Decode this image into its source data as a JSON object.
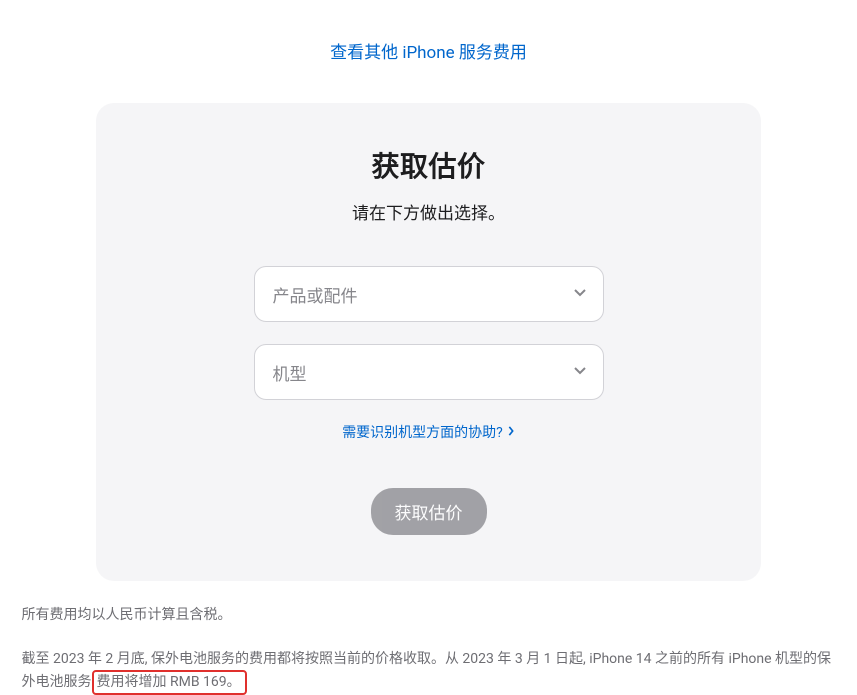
{
  "topLink": {
    "label": "查看其他 iPhone 服务费用"
  },
  "card": {
    "title": "获取估价",
    "subtitle": "请在下方做出选择。",
    "selectProduct": {
      "placeholder": "产品或配件"
    },
    "selectModel": {
      "placeholder": "机型"
    },
    "helpLink": {
      "label": "需要识别机型方面的协助?"
    },
    "submitButton": {
      "label": "获取估价"
    }
  },
  "footer": {
    "line1": "所有费用均以人民币计算且含税。",
    "line2_part1": "截至 2023 年 2 月底, 保外电池服务的费用都将按照当前的价格收取。从 2023 年 3 月 1 日起, iPhone 14 之前的所有 iPhone 机型的保外电池服务",
    "line2_highlight": "费用将增加 RMB 169。"
  }
}
